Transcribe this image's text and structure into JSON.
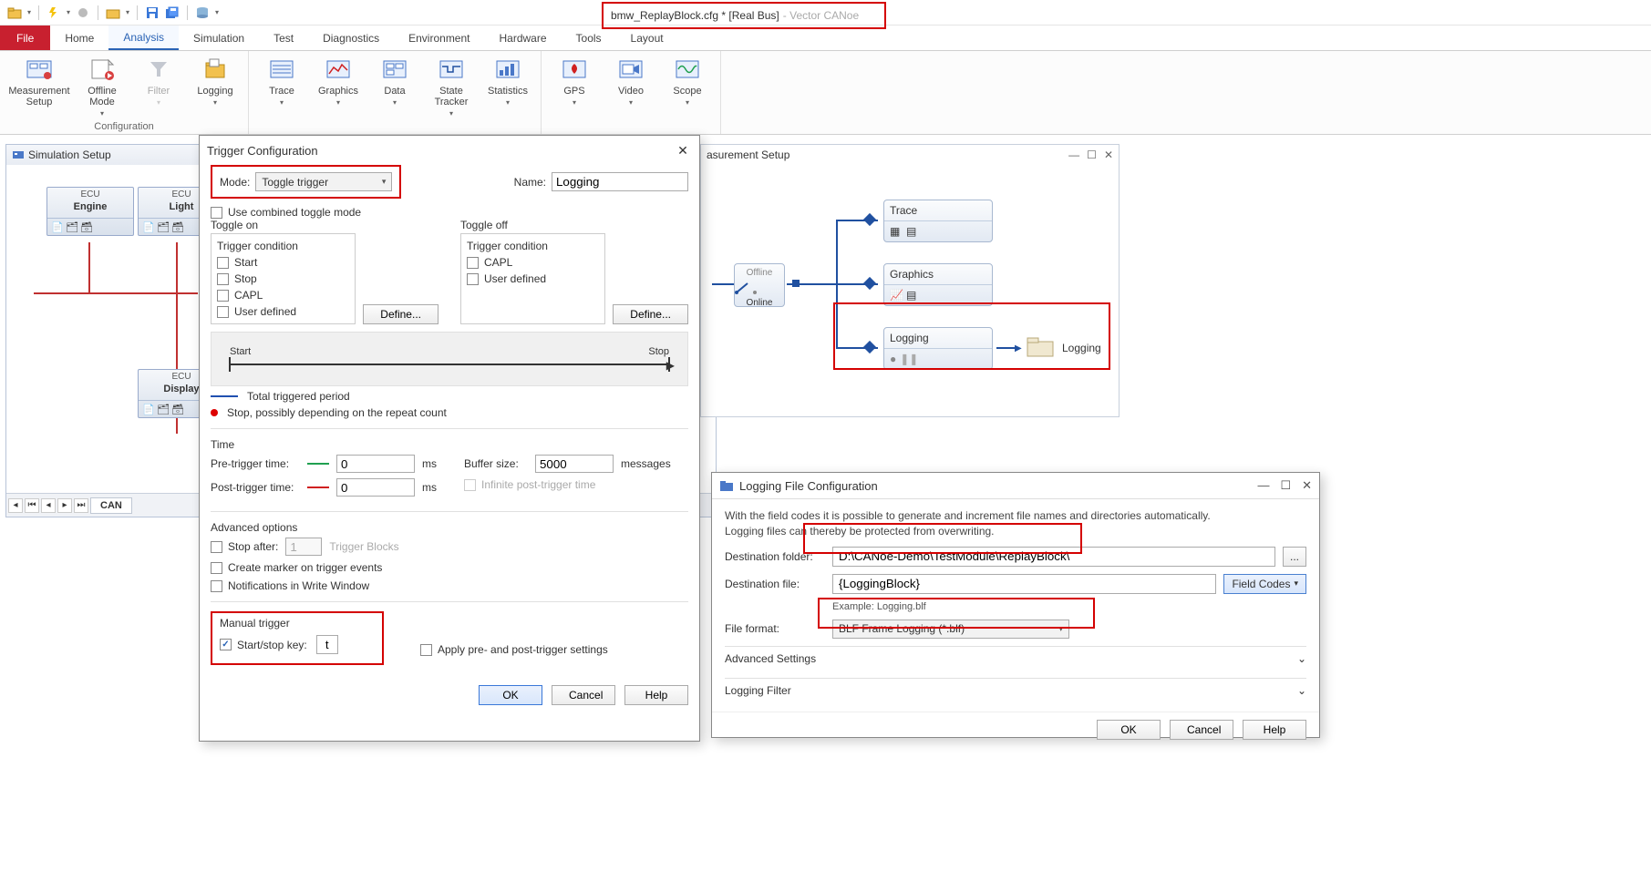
{
  "title": {
    "file": "bmw_ReplayBlock.cfg *",
    "bus": "[Real Bus]",
    "app": " - Vector CANoe"
  },
  "tabs": {
    "file": "File",
    "home": "Home",
    "analysis": "Analysis",
    "simulation": "Simulation",
    "test": "Test",
    "diag": "Diagnostics",
    "env": "Environment",
    "hw": "Hardware",
    "tools": "Tools",
    "layout": "Layout"
  },
  "ribbon": {
    "g1": {
      "label": "Configuration",
      "i1": "Measurement\nSetup",
      "i2": "Offline\nMode",
      "i3": "Filter",
      "i4": "Logging"
    },
    "g2": {
      "label": "",
      "i1": "Trace",
      "i2": "Graphics",
      "i3": "Data",
      "i4": "State\nTracker",
      "i5": "Statistics"
    },
    "g3": {
      "label": "",
      "i1": "GPS",
      "i2": "Video",
      "i3": "Scope"
    }
  },
  "sim": {
    "title": "Simulation Setup",
    "ecu1t": "ECU",
    "ecu1n": "Engine",
    "ecu2t": "ECU",
    "ecu2n": "Light",
    "ecu3t": "ECU",
    "ecu3n": "Display",
    "tab": "CAN"
  },
  "meas": {
    "title": "asurement Setup",
    "offline": "Offline",
    "online": "Online",
    "trace": "Trace",
    "graphics": "Graphics",
    "logging": "Logging",
    "loglabel": "Logging"
  },
  "trig": {
    "title": "Trigger Configuration",
    "modeLbl": "Mode:",
    "modeVal": "Toggle trigger",
    "nameLbl": "Name:",
    "nameVal": "Logging",
    "combined": "Use combined toggle mode",
    "toggleOn": "Toggle on",
    "toggleOff": "Toggle off",
    "tc": "Trigger condition",
    "start": "Start",
    "stop": "Stop",
    "capl": "CAPL",
    "ud": "User defined",
    "define": "Define...",
    "startlbl": "Start",
    "stoplbl": "Stop",
    "leg1": "Total triggered period",
    "leg2": "Stop, possibly depending on the repeat count",
    "time": "Time",
    "pre": "Pre-trigger time:",
    "post": "Post-trigger time:",
    "preVal": "0",
    "postVal": "0",
    "ms": "ms",
    "buf": "Buffer size:",
    "bufVal": "5000",
    "msgs": "messages",
    "inf": "Infinite post-trigger time",
    "adv": "Advanced options",
    "stopafter": "Stop after:",
    "stopafterVal": "1",
    "stopafterUnit": "Trigger Blocks",
    "marker": "Create marker on trigger events",
    "notif": "Notifications in Write Window",
    "man": "Manual trigger",
    "sskey": "Start/stop key:",
    "sskeyVal": "t",
    "apply": "Apply pre- and post-trigger settings",
    "ok": "OK",
    "cancel": "Cancel",
    "help": "Help"
  },
  "logdlg": {
    "title": "Logging File Configuration",
    "info1": "With the field codes it is possible to generate and increment file names and directories automatically.",
    "info2": "Logging files can thereby be protected from overwriting.",
    "folderLbl": "Destination folder:",
    "folderVal": "D:\\CANoe-Demo\\TestModule\\ReplayBlock\\",
    "fileLbl": "Destination file:",
    "fileVal": "{LoggingBlock}",
    "example": "Example: Logging.blf",
    "fmtLbl": "File format:",
    "fmtVal": "BLF Frame Logging (*.blf)",
    "fieldcodes": "Field Codes",
    "advset": "Advanced Settings",
    "filter": "Logging Filter",
    "ok": "OK",
    "cancel": "Cancel",
    "help": "Help",
    "browse": "..."
  }
}
